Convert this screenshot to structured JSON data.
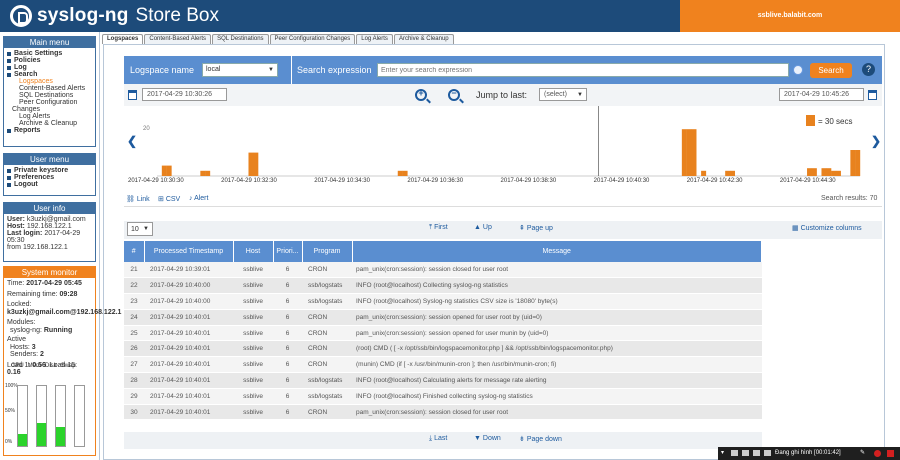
{
  "header": {
    "brand_bold": "syslog-ng",
    "brand_rest": "Store Box",
    "host": "ssblive.balabit.com"
  },
  "main_menu": {
    "title": "Main menu",
    "items": [
      {
        "label": "Basic Settings",
        "level": 0
      },
      {
        "label": "Policies",
        "level": 0
      },
      {
        "label": "Log",
        "level": 0
      },
      {
        "label": "Search",
        "level": 0
      },
      {
        "label": "Logspaces",
        "level": 1,
        "active": true
      },
      {
        "label": "Content-Based Alerts",
        "level": 1
      },
      {
        "label": "SQL Destinations",
        "level": 1
      },
      {
        "label": "Peer Configuration",
        "level": 1
      },
      {
        "label": "Changes",
        "level": 2
      },
      {
        "label": "Log Alerts",
        "level": 1
      },
      {
        "label": "Archive & Cleanup",
        "level": 1
      },
      {
        "label": "Reports",
        "level": 0
      }
    ]
  },
  "user_menu": {
    "title": "User menu",
    "items": [
      "Private keystore",
      "Preferences",
      "Logout"
    ]
  },
  "user_info": {
    "title": "User info",
    "user_k": "User:",
    "user_v": "k3uzkj@gmail.com",
    "host_k": "Host:",
    "host_v": "192.168.122.1",
    "last_k": "Last login:",
    "last_v": "2017-04-29",
    "last_time": "05:30",
    "from": "from 192.168.122.1"
  },
  "system_monitor": {
    "title": "System monitor",
    "time_k": "Time:",
    "time_v": "2017-04-29 05:45",
    "remain_k": "Remaining time:",
    "remain_v": "09:28",
    "locked_k": "Locked:",
    "locked_v": "k3uzkj@gmail.com@192.168.122.1",
    "modules_k": "Modules:",
    "module_name": "syslog-ng:",
    "module_state": "Running",
    "active_k": "Active",
    "hosts_k": "Hosts:",
    "hosts_v": "3",
    "senders_k": "Senders:",
    "senders_v": "2",
    "load1_k": "Load 1:",
    "load1_v": "0.56",
    "load15_k": "Load 15:",
    "load15_v": "0.16",
    "meter_labels": [
      "CPU",
      "Mem",
      "Disk",
      "Swap"
    ],
    "meter_levels": [
      0.2,
      0.38,
      0.32,
      0
    ],
    "scale": [
      "100%",
      "50%",
      "0%"
    ]
  },
  "tabs": [
    "Logspaces",
    "Content-Based Alerts",
    "SQL Destinations",
    "Peer Configuration Changes",
    "Log Alerts",
    "Archive & Cleanup"
  ],
  "search": {
    "logspace_label": "Logspace name",
    "logspace_value": "local",
    "expr_label": "Search expression",
    "expr_placeholder": "Enter your search expression",
    "button": "Search",
    "help": "?"
  },
  "time": {
    "start": "2017-04-29 10:30:26",
    "end": "2017-04-29 10:45:26",
    "jump_label": "Jump to last:",
    "jump_value": "(select)"
  },
  "chart_data": {
    "type": "bar",
    "y_tick": "20",
    "legend": "= 30 secs",
    "legend_color": "#e8821e",
    "x_ticks": [
      "2017-04-29 10:30:30",
      "2017-04-29 10:32:30",
      "2017-04-29 10:34:30",
      "2017-04-29 10:36:30",
      "2017-04-29 10:38:30",
      "2017-04-29 10:40:30",
      "2017-04-29 10:42:30",
      "2017-04-29 10:44:30"
    ],
    "values": [
      0,
      4,
      4,
      0,
      0,
      0,
      0,
      0,
      0,
      2,
      2,
      0,
      0,
      0,
      0,
      0,
      0,
      0,
      0,
      9,
      9,
      0,
      0,
      0,
      0,
      0,
      0,
      0,
      0,
      0,
      0,
      0,
      0,
      0,
      0,
      0,
      0,
      0,
      0,
      0,
      0,
      0,
      0,
      0,
      0,
      0,
      0,
      0,
      0,
      0,
      2,
      2,
      0,
      0,
      0,
      0,
      0,
      0,
      0,
      0,
      0,
      0,
      0,
      0,
      0,
      0,
      0,
      0,
      0,
      0,
      0,
      0,
      0,
      0,
      0,
      0,
      0,
      0,
      0,
      0,
      0,
      0,
      0,
      0,
      0,
      0,
      0,
      0,
      0,
      0,
      0,
      0,
      0,
      0,
      0,
      0,
      0,
      0,
      0,
      0,
      0,
      0,
      0,
      0,
      0,
      0,
      0,
      0,
      0,
      18,
      18,
      18,
      0,
      2,
      0,
      0,
      0,
      0,
      2,
      2,
      0,
      0,
      0,
      0,
      0,
      0,
      0,
      0,
      0,
      0,
      0,
      0,
      0,
      0,
      0,
      3,
      3,
      0,
      3,
      3,
      2,
      2,
      0,
      0,
      10,
      10
    ]
  },
  "toolbar": {
    "link": "Link",
    "csv": "CSV",
    "alert": "Alert",
    "results": "Search results: 70"
  },
  "pager": {
    "per_page": "10",
    "first": "First",
    "up": "Up",
    "page_up": "Page up",
    "customize": "Customize columns",
    "last": "Last",
    "down": "Down",
    "page_down": "Page down"
  },
  "grid": {
    "headers": [
      "#",
      "Processed Timestamp",
      "Host",
      "Priori...",
      "Program",
      "Message"
    ],
    "rows": [
      [
        "21",
        "2017-04-29 10:39:01",
        "ssblive",
        "6",
        "CRON",
        "pam_unix(cron:session): session closed for user root"
      ],
      [
        "22",
        "2017-04-29 10:40:00",
        "ssblive",
        "6",
        "ssb/logstats",
        "INFO (root@localhost) Collecting syslog-ng statistics"
      ],
      [
        "23",
        "2017-04-29 10:40:00",
        "ssblive",
        "6",
        "ssb/logstats",
        "INFO (root@localhost) Syslog-ng statistics CSV size is '18080' byte(s)"
      ],
      [
        "24",
        "2017-04-29 10:40:01",
        "ssblive",
        "6",
        "CRON",
        "pam_unix(cron:session): session opened for user root by (uid=0)"
      ],
      [
        "25",
        "2017-04-29 10:40:01",
        "ssblive",
        "6",
        "CRON",
        "pam_unix(cron:session): session opened for user munin by (uid=0)"
      ],
      [
        "26",
        "2017-04-29 10:40:01",
        "ssblive",
        "6",
        "CRON",
        "(root) CMD ( [ -x /opt/ssb/bin/logspacemonitor.php ] && /opt/ssb/bin/logspacemonitor.php)"
      ],
      [
        "27",
        "2017-04-29 10:40:01",
        "ssblive",
        "6",
        "CRON",
        "(munin) CMD (if [ -x /usr/bin/munin-cron ]; then /usr/bin/munin-cron; fi)"
      ],
      [
        "28",
        "2017-04-29 10:40:01",
        "ssblive",
        "6",
        "ssb/logstats",
        "INFO (root@localhost) Calculating alerts for message rate alerting"
      ],
      [
        "29",
        "2017-04-29 10:40:01",
        "ssblive",
        "6",
        "ssb/logstats",
        "INFO (root@localhost) Finished collecting syslog-ng statistics"
      ],
      [
        "30",
        "2017-04-29 10:40:01",
        "ssblive",
        "6",
        "CRON",
        "pam_unix(cron:session): session closed for user root"
      ]
    ]
  },
  "taskbar": {
    "recording": "Đang ghi hình [00:01:42]"
  }
}
